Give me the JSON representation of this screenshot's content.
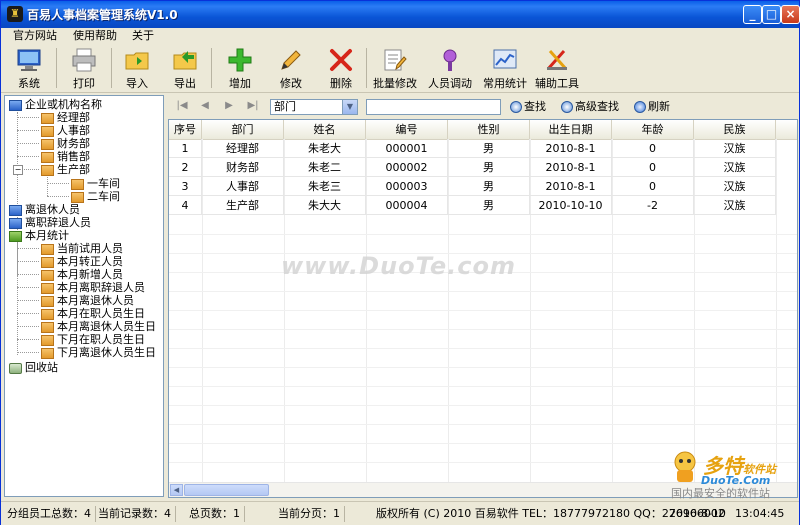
{
  "window": {
    "title": "百易人事档案管理系统V1.0"
  },
  "menu": [
    {
      "label": "官方网站"
    },
    {
      "label": "使用帮助"
    },
    {
      "label": "关于"
    }
  ],
  "toolbar": [
    {
      "label": "系统",
      "icon": "monitor-icon"
    },
    {
      "label": "打印",
      "icon": "printer-icon"
    },
    {
      "label": "导入",
      "icon": "import-folder-icon"
    },
    {
      "label": "导出",
      "icon": "export-folder-icon"
    },
    {
      "label": "增加",
      "icon": "plus-icon"
    },
    {
      "label": "修改",
      "icon": "pencil-icon"
    },
    {
      "label": "删除",
      "icon": "delete-x-icon"
    },
    {
      "label": "批量修改",
      "icon": "batch-edit-icon"
    },
    {
      "label": "人员调动",
      "icon": "transfer-icon"
    },
    {
      "label": "常用统计",
      "icon": "statistics-icon"
    },
    {
      "label": "辅助工具",
      "icon": "tools-icon"
    }
  ],
  "tree": {
    "root": "企业或机构名称",
    "departments": [
      "经理部",
      "人事部",
      "财务部",
      "销售部",
      "生产部"
    ],
    "workshops": [
      "一车间",
      "二车间"
    ],
    "retired": "离退休人员",
    "resigned": "离职辞退人员",
    "monthly_stats": "本月统计",
    "stats_items": [
      "当前试用人员",
      "本月转正人员",
      "本月新增人员",
      "本月离职辞退人员",
      "本月离退休人员",
      "本月在职人员生日",
      "本月离退休人员生日",
      "下月在职人员生日",
      "下月离退休人员生日"
    ],
    "recycle": "回收站",
    "expander_minus": "−"
  },
  "navbar": {
    "first": "|◀",
    "prev": "◀",
    "next": "▶",
    "last": "▶|",
    "dept_value": "部门",
    "search_value": "",
    "search_btn": "查找",
    "advanced_btn": "高级查找",
    "refresh_btn": "刷新"
  },
  "table": {
    "columns": [
      "序号",
      "部门",
      "姓名",
      "编号",
      "性别",
      "出生日期",
      "年龄",
      "民族"
    ],
    "rows": [
      [
        "1",
        "经理部",
        "朱老大",
        "000001",
        "男",
        "2010-8-1",
        "0",
        "汉族"
      ],
      [
        "2",
        "财务部",
        "朱老二",
        "000002",
        "男",
        "2010-8-1",
        "0",
        "汉族"
      ],
      [
        "3",
        "人事部",
        "朱老三",
        "000003",
        "男",
        "2010-8-1",
        "0",
        "汉族"
      ],
      [
        "4",
        "生产部",
        "朱大大",
        "000004",
        "男",
        "2010-10-10",
        "-2",
        "汉族"
      ]
    ]
  },
  "status": {
    "group_total": "分组员工总数：4",
    "current_records": "当前记录数：4",
    "total_pages": "总页数：1",
    "current_page": "当前分页：1",
    "copyright": "版权所有 (C) 2010 百易软件 TEL：18777972180 QQ：276966002",
    "date": "2010-8-10",
    "time": "13:04:45"
  },
  "watermark": "www.DuoTe.com",
  "logo": {
    "brand": "多特",
    "brand_suffix": "软件站",
    "site": "DuoTe.Com",
    "tagline": "国内最安全的软件站"
  },
  "colors": {
    "title_bar": "#0a5fe8",
    "window_bg": "#ece9d8",
    "accent_orange": "#e6a210"
  }
}
